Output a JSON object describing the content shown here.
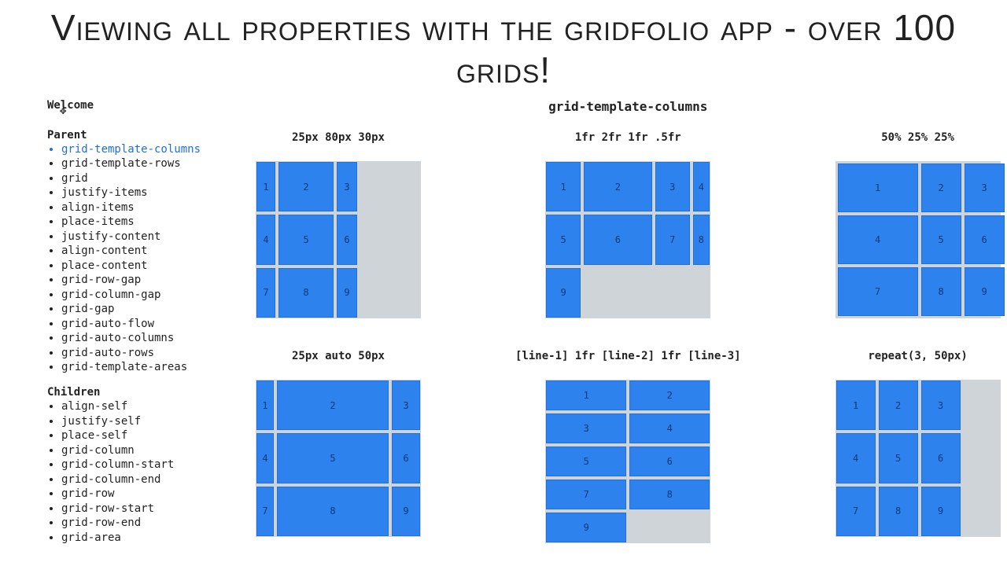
{
  "title": "Viewing all properties with the gridfolio app - over 100 grids!",
  "sidebar": {
    "welcome": "Welcome",
    "parent_head": "Parent",
    "parent_items": [
      "grid-template-columns",
      "grid-template-rows",
      "grid",
      "justify-items",
      "align-items",
      "place-items",
      "justify-content",
      "align-content",
      "place-content",
      "grid-row-gap",
      "grid-column-gap",
      "grid-gap",
      "grid-auto-flow",
      "grid-auto-columns",
      "grid-auto-rows",
      "grid-template-areas"
    ],
    "parent_active_index": 0,
    "children_head": "Children",
    "children_items": [
      "align-self",
      "justify-self",
      "place-self",
      "grid-column",
      "grid-column-start",
      "grid-column-end",
      "grid-row",
      "grid-row-start",
      "grid-row-end",
      "grid-area"
    ]
  },
  "section_title": "grid-template-columns",
  "examples": [
    {
      "label": "25px 80px 30px",
      "grid_class": "g1",
      "cells": 9
    },
    {
      "label": "1fr 2fr 1fr .5fr",
      "grid_class": "g2",
      "cells": 9
    },
    {
      "label": "50% 25% 25%",
      "grid_class": "g3",
      "cells": 9
    },
    {
      "label": "25px auto 50px",
      "grid_class": "g4",
      "cells": 9
    },
    {
      "label": "[line-1] 1fr [line-2] 1fr [line-3]",
      "grid_class": "g5",
      "cells": 9
    },
    {
      "label": "repeat(3, 50px)",
      "grid_class": "g6",
      "cells": 9
    }
  ]
}
